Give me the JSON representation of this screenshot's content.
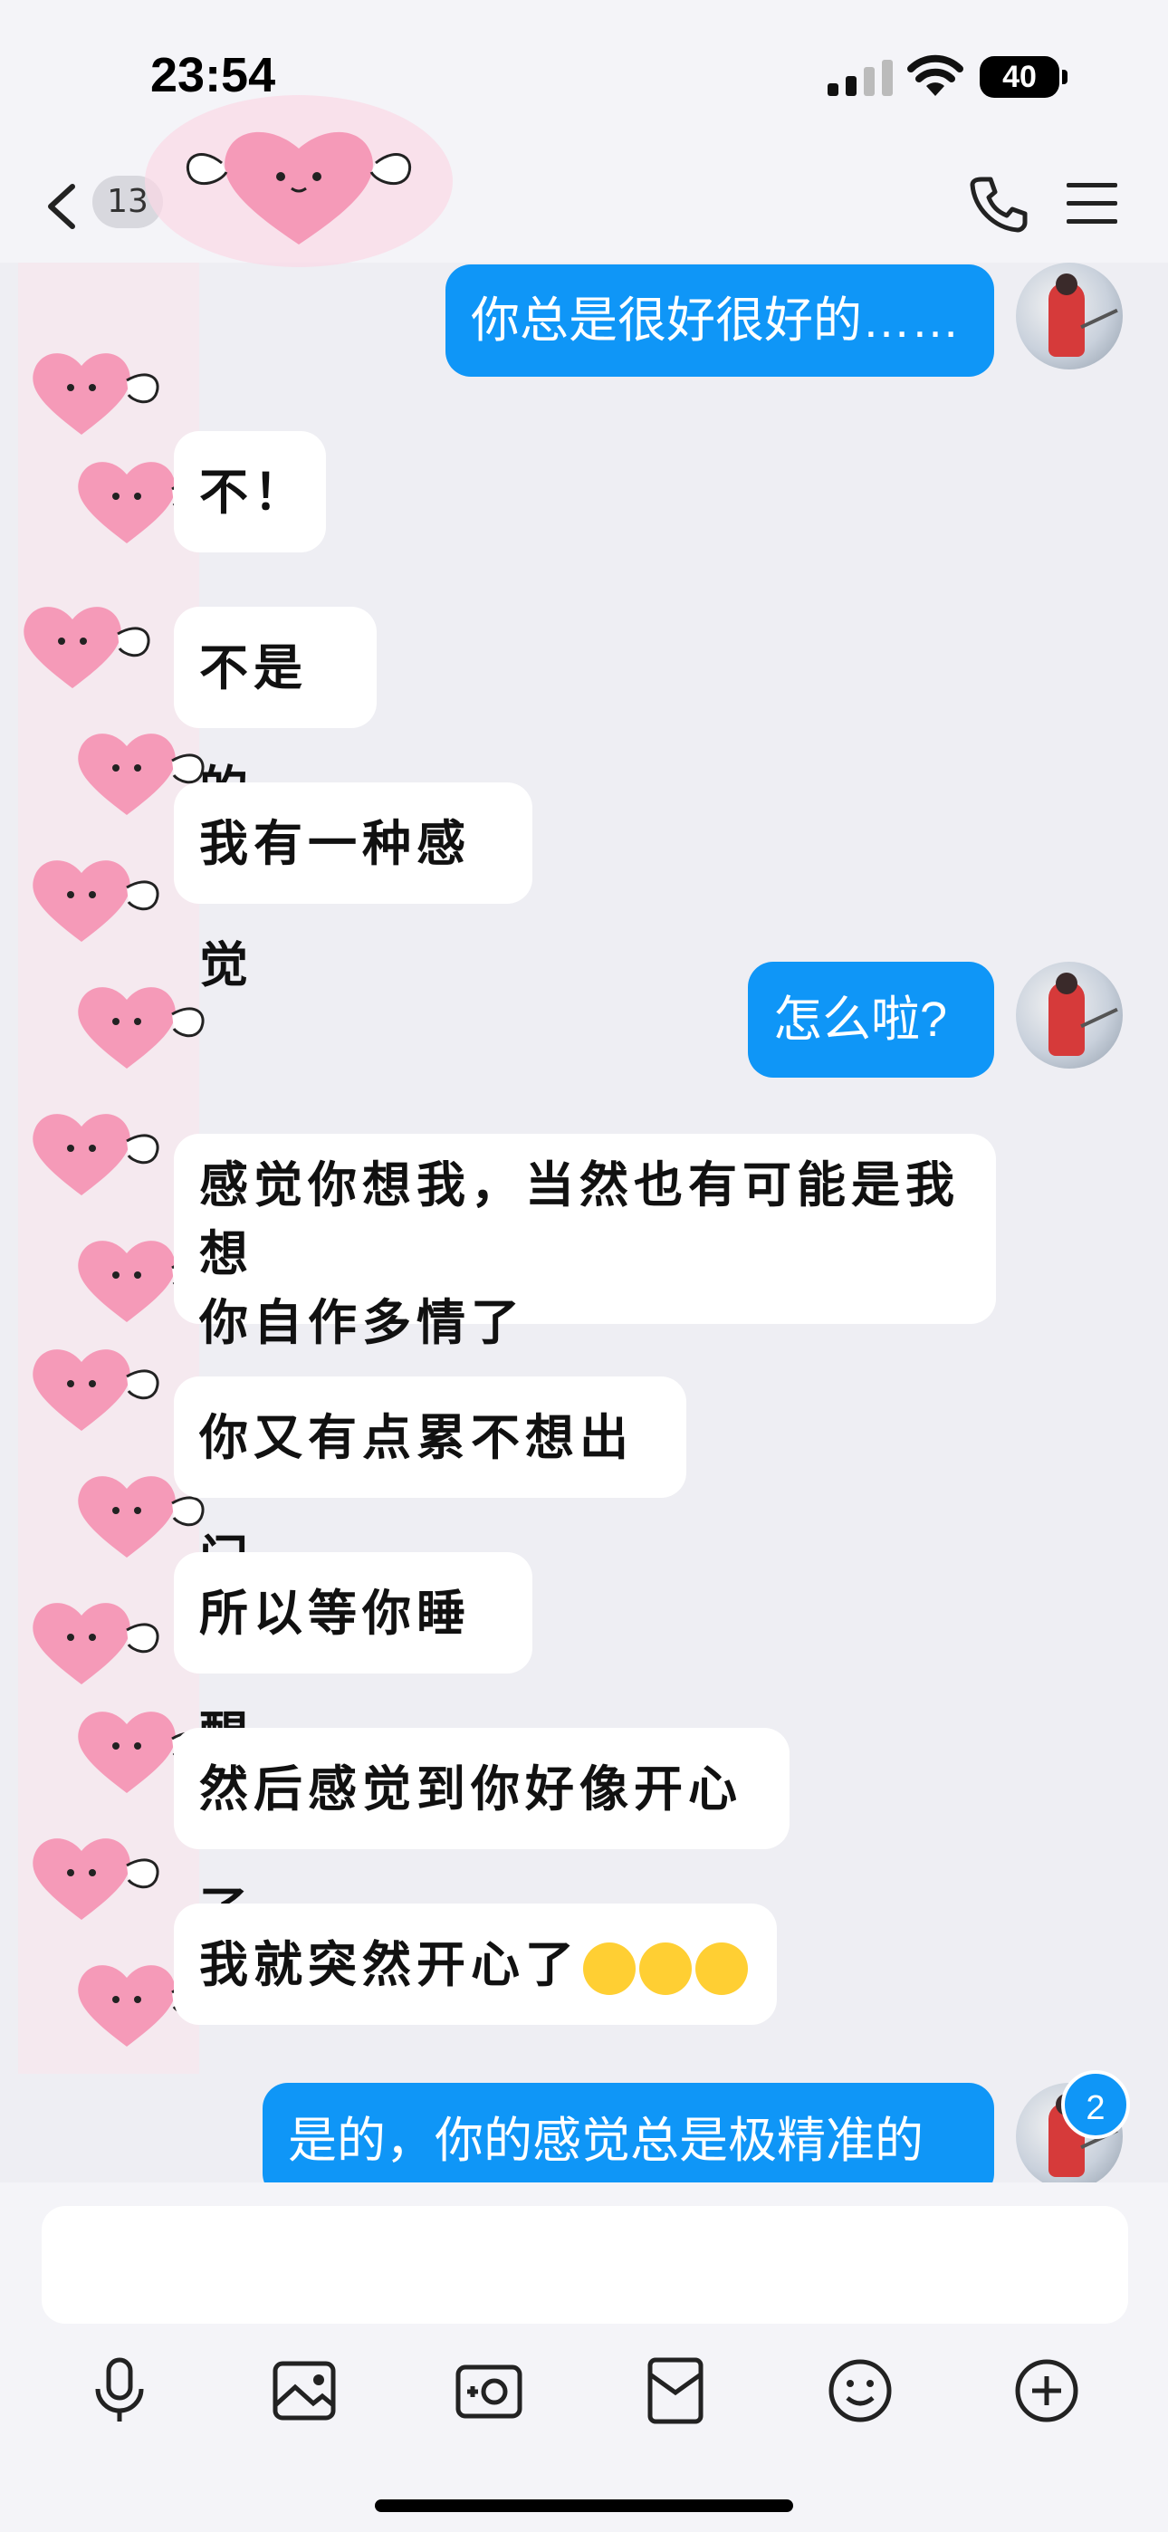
{
  "status_bar": {
    "time": "23:54",
    "battery": "40"
  },
  "nav": {
    "unread_count": "13"
  },
  "messages": [
    {
      "dir": "out",
      "text": "你总是很好很好的……"
    },
    {
      "dir": "in",
      "text": "不！"
    },
    {
      "dir": "in",
      "text": "不是的"
    },
    {
      "dir": "in",
      "text": "我有一种感觉"
    },
    {
      "dir": "out",
      "text": "怎么啦?"
    },
    {
      "dir": "in",
      "text": "感觉你想我，当然也有可能是我想"
    },
    {
      "dir": "in",
      "text": "你自作多情了"
    },
    {
      "dir": "in",
      "text": "你又有点累不想出门"
    },
    {
      "dir": "in",
      "text": "所以等你睡醒"
    },
    {
      "dir": "in",
      "text": "然后感觉到你好像开心了"
    },
    {
      "dir": "in",
      "text": "我就突然开心了"
    },
    {
      "dir": "out",
      "text": "是的，你的感觉总是极精准的"
    }
  ],
  "new_message_badge": "2",
  "composer": {
    "placeholder": ""
  },
  "icons": [
    "back-icon",
    "phone-icon",
    "menu-icon",
    "microphone-icon",
    "image-icon",
    "camera-icon",
    "red-packet-icon",
    "emoji-icon",
    "plus-icon",
    "laughing-emoji-icon"
  ],
  "colors": {
    "outgoing_bubble": "#0f96f7",
    "incoming_bubble": "#ffffff",
    "background": "#eeeef3"
  }
}
